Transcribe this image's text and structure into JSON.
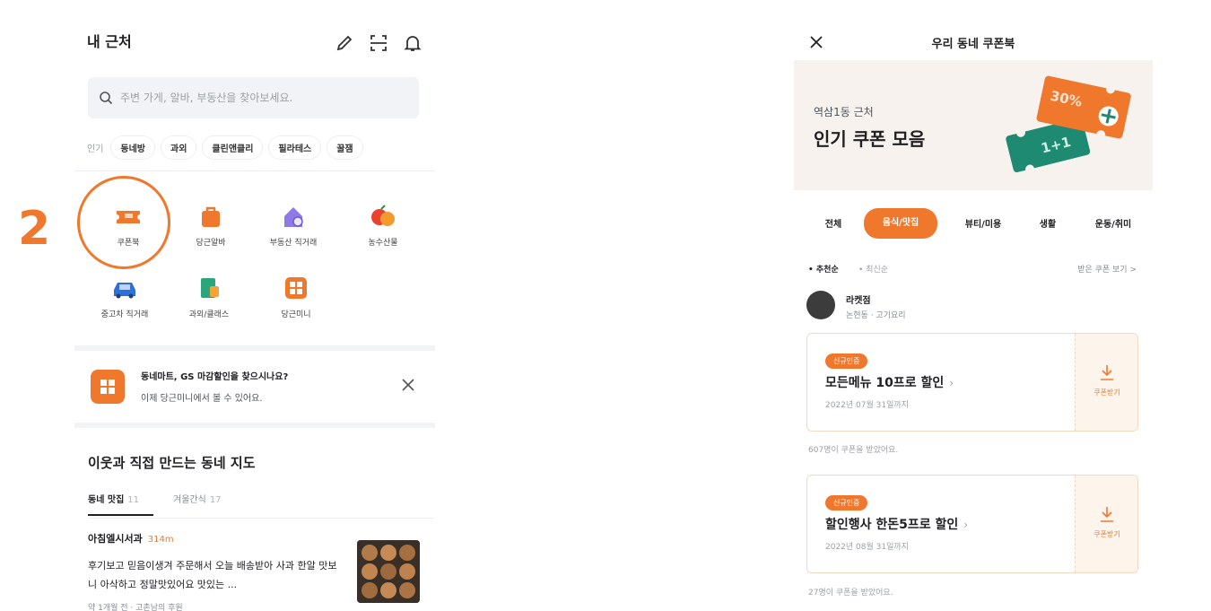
{
  "step_number": "2",
  "left": {
    "title": "내 근처",
    "search": {
      "placeholder": "주변 가게, 알바, 부동산을 찾아보세요."
    },
    "chips_label": "인기",
    "chips": [
      "동네방",
      "과외",
      "클린앤클리",
      "필라테스",
      "꿀잼"
    ],
    "grid": [
      {
        "label": "쿠폰북",
        "icon": "ticket-icon"
      },
      {
        "label": "당근알바",
        "icon": "bag-icon"
      },
      {
        "label": "부동산 직거래",
        "icon": "house-icon"
      },
      {
        "label": "농수산물",
        "icon": "fruit-icon"
      },
      {
        "label": "중고차 직거래",
        "icon": "car-icon"
      },
      {
        "label": "과외/클래스",
        "icon": "book-icon"
      },
      {
        "label": "당근미니",
        "icon": "grid-icon"
      }
    ],
    "banner": {
      "title": "동네마트, GS 마감할인을 찾으시나요?",
      "subtitle": "이제 당근미니에서 볼 수 있어요."
    },
    "map": {
      "title": "이웃과 직접 만드는 동네 지도",
      "tabs": [
        {
          "label": "동네 맛집",
          "count": "11"
        },
        {
          "label": "겨울간식",
          "count": "17"
        }
      ]
    },
    "post": {
      "title": "아침엘시서과",
      "distance": "314m",
      "body": "후기보고 믿음이생겨 주문해서 오늘 배송받아 사과 한알 맛보니 아삭하고 정말맛있어요 맛있는 ...",
      "meta": "약 1개월 전 · 고촌남의 후원"
    }
  },
  "right": {
    "title": "우리 동네 쿠폰북",
    "hero": {
      "subtitle": "역삼1동 근처",
      "title": "인기 쿠폰 모음",
      "ticket_top": "30%",
      "ticket_bottom": "1+1"
    },
    "categories": [
      "전체",
      "음식/맛집",
      "뷰티/미용",
      "생활",
      "운동/취미"
    ],
    "sort": {
      "option_a": "• 추천순",
      "option_b": "• 최신순",
      "link": "받은 쿠폰 보기 >"
    },
    "store": {
      "name": "라켓점",
      "meta": "논현동 · 고기요리"
    },
    "coupons": [
      {
        "tag": "신규인증",
        "title": "모든메뉴 10프로 할인",
        "date": "2022년 07월 31일까지",
        "action": "쿠폰받기",
        "note": "607명이 쿠폰을 받았어요."
      },
      {
        "tag": "신규인증",
        "title": "할인행사 한돈5프로 할인",
        "date": "2022년 08월 31일까지",
        "action": "쿠폰받기",
        "note": "27명이 쿠폰을 받았어요."
      }
    ]
  },
  "colors": {
    "accent": "#f0782d",
    "teal": "#1f8a72",
    "text": "#212124",
    "muted": "#868b94"
  }
}
